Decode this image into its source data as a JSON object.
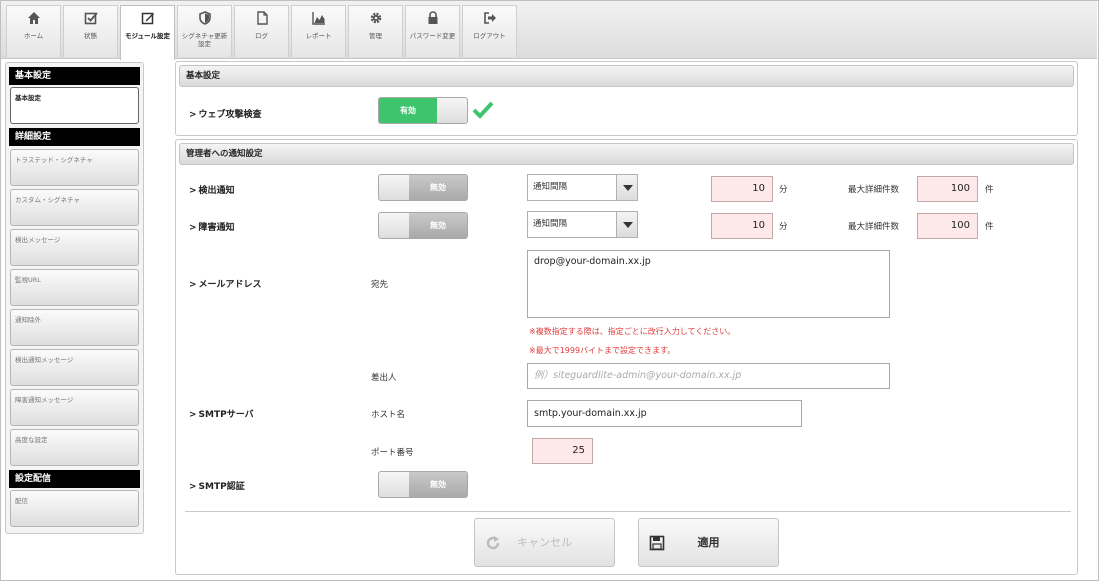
{
  "nav": {
    "tabs": [
      {
        "label": "ホーム",
        "icon": "home-icon"
      },
      {
        "label": "状態",
        "icon": "checkbox-icon"
      },
      {
        "label": "モジュール設定",
        "icon": "edit-icon"
      },
      {
        "label": "シグネチャ更新設定",
        "icon": "shield-icon"
      },
      {
        "label": "ログ",
        "icon": "file-icon"
      },
      {
        "label": "レポート",
        "icon": "chart-icon"
      },
      {
        "label": "管理",
        "icon": "gear-icon"
      },
      {
        "label": "パスワード変更",
        "icon": "lock-icon"
      },
      {
        "label": "ログアウト",
        "icon": "logout-icon"
      }
    ]
  },
  "sidebar": {
    "sections": [
      {
        "title": "基本設定",
        "items": [
          "基本設定"
        ]
      },
      {
        "title": "詳細設定",
        "items": [
          "トラステッド・シグネチャ",
          "カスタム・シグネチャ",
          "検出メッセージ",
          "監視URL",
          "通知除外",
          "検出通知メッセージ",
          "障害通知メッセージ",
          "高度な設定"
        ]
      },
      {
        "title": "設定配信",
        "items": [
          "配信"
        ]
      }
    ]
  },
  "basic": {
    "header": "基本設定",
    "web_attack_label": "ウェブ攻撃検査",
    "web_attack_toggle": "有効"
  },
  "notify": {
    "header": "管理者への通知設定",
    "detect_label": "検出通知",
    "detect_toggle": "無効",
    "detect_interval": "通知間隔",
    "detect_minutes": "10",
    "detect_minutes_unit": "分",
    "detect_max_label": "最大詳細件数",
    "detect_max": "100",
    "detect_max_unit": "件",
    "fault_label": "障害通知",
    "fault_toggle": "無効",
    "fault_interval": "通知間隔",
    "fault_minutes": "10",
    "fault_minutes_unit": "分",
    "fault_max_label": "最大詳細件数",
    "fault_max": "100",
    "fault_max_unit": "件",
    "mail_label": "メールアドレス",
    "to_label": "宛先",
    "to_value": "drop@your-domain.xx.jp",
    "note1": "※複数指定する際は、指定ごとに改行入力してください。",
    "note2": "※最大で1999バイトまで設定できます。",
    "from_label": "差出人",
    "from_placeholder": "例）siteguardlite-admin@your-domain.xx.jp",
    "smtp_label": "SMTPサーバ",
    "host_label": "ホスト名",
    "host_value": "smtp.your-domain.xx.jp",
    "port_label": "ポート番号",
    "port_value": "25",
    "smtp_auth_label": "SMTP認証",
    "smtp_auth_toggle": "無効"
  },
  "actions": {
    "cancel": "キャンセル",
    "apply": "適用"
  },
  "colors": {
    "enabled_green": "#3ec46c",
    "note_red": "#e03c3c",
    "number_bg": "#fde9e9"
  }
}
